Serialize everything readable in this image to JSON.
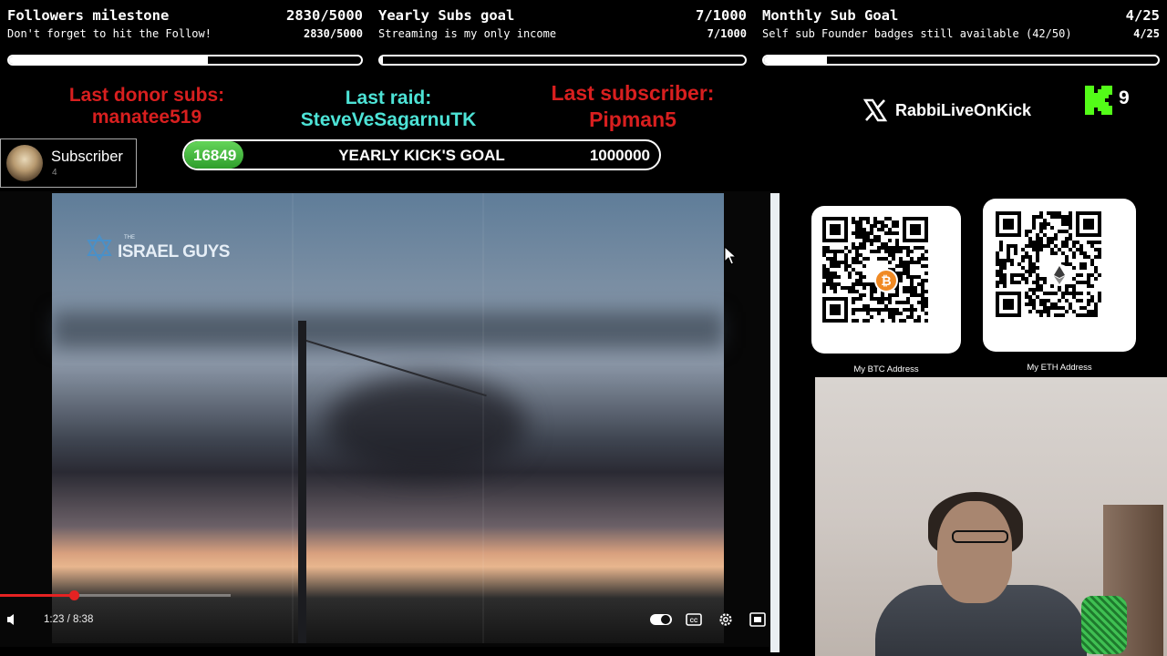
{
  "goals": [
    {
      "title": "Followers milestone",
      "count": "2830/5000",
      "subtitle": "Don't forget to hit the Follow!",
      "count2": "2830/5000",
      "progress": 0.566
    },
    {
      "title": "Yearly Subs goal",
      "count": "7/1000",
      "subtitle": "Streaming is my only income",
      "count2": "7/1000",
      "progress": 0.007
    },
    {
      "title": "Monthly Sub Goal",
      "count": "4/25",
      "subtitle": "Self sub Founder badges still available (42/50)",
      "count2": "4/25",
      "progress": 0.16
    }
  ],
  "alerts": {
    "donor": {
      "label": "Last donor subs:",
      "name": "manatee519"
    },
    "raid": {
      "label": "Last raid:",
      "name": "SteveVeSagarnuTK"
    },
    "subscriber": {
      "label": "Last subscriber:",
      "name": "Pipman5"
    }
  },
  "sub_card": {
    "label": "Subscriber",
    "count": "4"
  },
  "kick_goal": {
    "current": "16849",
    "label": "YEARLY KICK'S GOAL",
    "total": "1000000",
    "progress": 0.0168
  },
  "social": {
    "x_handle": "RabbiLiveOnKick",
    "kick_count": "9"
  },
  "video": {
    "channel_small": "THE",
    "channel_name": "ISRAEL GUYS",
    "time": "1:23 / 8:38",
    "progress": 0.16
  },
  "crypto": {
    "btc_caption": "My BTC Address",
    "eth_caption": "My ETH Address"
  },
  "colors": {
    "alert_red": "#d81f1f",
    "alert_cyan": "#4de3d6",
    "kick_green": "#53fc18",
    "progress_red": "#e52222"
  }
}
